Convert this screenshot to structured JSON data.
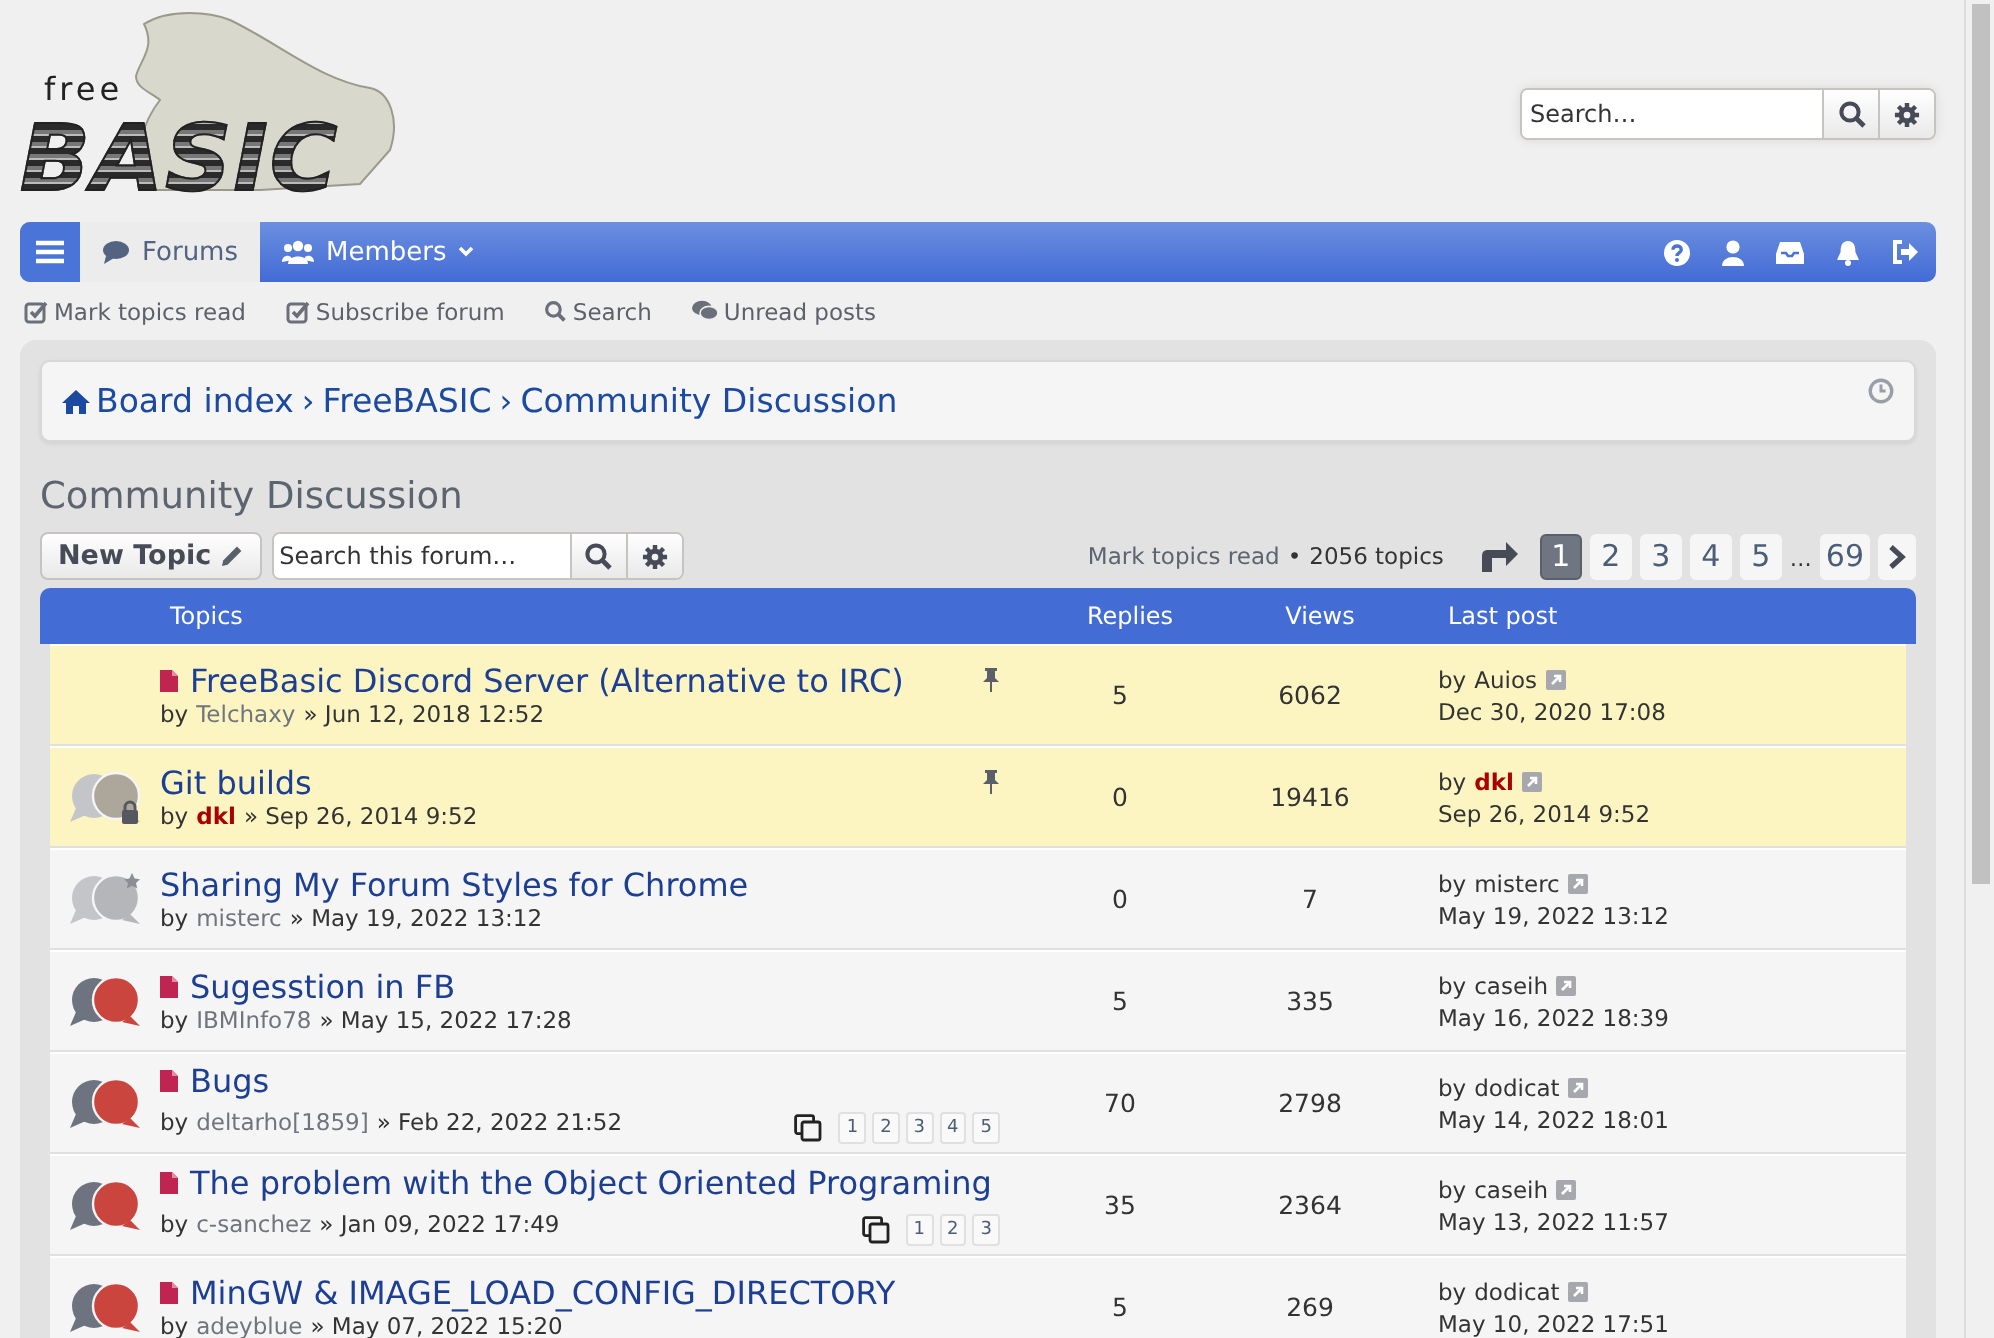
{
  "logo": {
    "small": "free",
    "big": "BASIC"
  },
  "header_search": {
    "placeholder": "Search…"
  },
  "navbar": {
    "tabs": [
      {
        "label": "Forums",
        "selected": true
      },
      {
        "label": "Members",
        "selected": false
      }
    ]
  },
  "quick_links": [
    {
      "kind": "check",
      "label": "Mark topics read"
    },
    {
      "kind": "check",
      "label": "Subscribe forum"
    },
    {
      "kind": "search",
      "label": "Search"
    },
    {
      "kind": "chat",
      "label": "Unread posts"
    }
  ],
  "breadcrumbs": [
    {
      "label": "Board index"
    },
    {
      "sep": "›",
      "label": "FreeBASIC"
    },
    {
      "sep": "›",
      "label": "Community Discussion"
    }
  ],
  "forum_title": "Community Discussion",
  "new_topic": "New Topic",
  "forum_search": {
    "placeholder": "Search this forum…"
  },
  "mark_read": "Mark topics read",
  "bullet": "•",
  "topic_count": "2056 topics",
  "pagination": [
    {
      "label": "1",
      "selected": true
    },
    {
      "label": "2",
      "selected": false
    },
    {
      "label": "3",
      "selected": false
    },
    {
      "label": "4",
      "selected": false
    },
    {
      "label": "5",
      "selected": false
    },
    {
      "label": "…",
      "kind": "gap"
    },
    {
      "label": "69",
      "selected": false
    }
  ],
  "table": {
    "columns": [
      "Topics",
      "Replies",
      "Views",
      "Last post"
    ],
    "rows": [
      {
        "kind": "none",
        "sticky": true,
        "new_post": true,
        "title": "FreeBasic Discord Server (Alternative to IRC)",
        "by": "by",
        "author": "Telchaxy",
        "author_admin": false,
        "date": "» Jun 12, 2018 12:52",
        "pages": [],
        "replies": "5",
        "views": "6062",
        "last_by_word": "by",
        "last_by": "Auios",
        "last_admin": false,
        "last_time": "Dec 30, 2020 17:08"
      },
      {
        "kind": "locked",
        "sticky": true,
        "new_post": false,
        "title": "Git builds",
        "by": "by",
        "author": "dkl",
        "author_admin": true,
        "date": "» Sep 26, 2014 9:52",
        "pages": [],
        "replies": "0",
        "views": "19416",
        "last_by_word": "by",
        "last_by": "dkl",
        "last_admin": true,
        "last_time": "Sep 26, 2014 9:52"
      },
      {
        "kind": "read_posted",
        "sticky": false,
        "new_post": false,
        "title": "Sharing My Forum Styles for Chrome",
        "by": "by",
        "author": "misterc",
        "author_admin": false,
        "date": "» May 19, 2022 13:12",
        "pages": [],
        "replies": "0",
        "views": "7",
        "last_by_word": "by",
        "last_by": "misterc",
        "last_admin": false,
        "last_time": "May 19, 2022 13:12"
      },
      {
        "kind": "unread",
        "sticky": false,
        "new_post": true,
        "title": "Sugesstion in FB",
        "by": "by",
        "author": "IBMInfo78",
        "author_admin": false,
        "date": "» May 15, 2022 17:28",
        "pages": [],
        "replies": "5",
        "views": "335",
        "last_by_word": "by",
        "last_by": "caseih",
        "last_admin": false,
        "last_time": "May 16, 2022 18:39"
      },
      {
        "kind": "unread",
        "sticky": false,
        "new_post": true,
        "title": "Bugs",
        "by": "by",
        "author": "deltarho[1859]",
        "author_admin": false,
        "date": "» Feb 22, 2022 21:52",
        "pages": [
          "1",
          "2",
          "3",
          "4",
          "5"
        ],
        "replies": "70",
        "views": "2798",
        "last_by_word": "by",
        "last_by": "dodicat",
        "last_admin": false,
        "last_time": "May 14, 2022 18:01"
      },
      {
        "kind": "unread",
        "sticky": false,
        "new_post": true,
        "title": "The problem with the Object Oriented Programing",
        "by": "by",
        "author": "c-sanchez",
        "author_admin": false,
        "date": "» Jan 09, 2022 17:49",
        "pages": [
          "1",
          "2",
          "3"
        ],
        "replies": "35",
        "views": "2364",
        "last_by_word": "by",
        "last_by": "caseih",
        "last_admin": false,
        "last_time": "May 13, 2022 11:57"
      },
      {
        "kind": "unread",
        "sticky": false,
        "new_post": true,
        "title": "MinGW & IMAGE_LOAD_CONFIG_DIRECTORY",
        "by": "by",
        "author": "adeyblue",
        "author_admin": false,
        "date": "» May 07, 2022 15:20",
        "pages": [],
        "replies": "5",
        "views": "269",
        "last_by_word": "by",
        "last_by": "dodicat",
        "last_admin": false,
        "last_time": "May 10, 2022 17:51"
      }
    ]
  }
}
